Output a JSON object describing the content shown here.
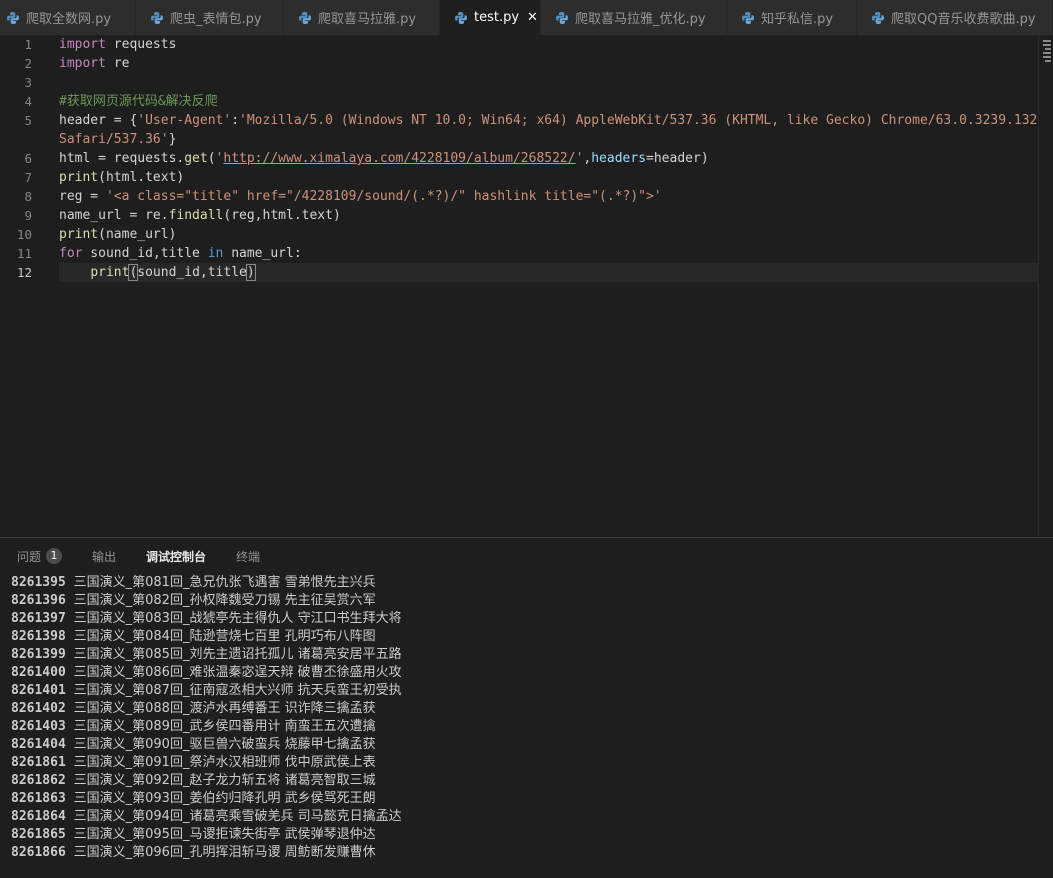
{
  "tabs": [
    {
      "label": "爬取全数网.py",
      "active": false
    },
    {
      "label": "爬虫_表情包.py",
      "active": false
    },
    {
      "label": "爬取喜马拉雅.py",
      "active": false
    },
    {
      "label": "test.py",
      "active": true
    },
    {
      "label": "爬取喜马拉雅_优化.py",
      "active": false
    },
    {
      "label": "知乎私信.py",
      "active": false
    },
    {
      "label": "爬取QQ音乐收费歌曲.py",
      "active": false
    }
  ],
  "editor": {
    "line_numbers": [
      "1",
      "2",
      "3",
      "4",
      "5",
      "",
      "6",
      "7",
      "8",
      "9",
      "10",
      "11",
      "12"
    ],
    "code": {
      "l1_kw": "import",
      "l1_rest": " requests",
      "l2_kw": "import",
      "l2_rest": " re",
      "l4_comment": "#获取网页源代码&解决反爬",
      "l5_a": "header = {",
      "l5_s1": "'User-Agent'",
      "l5_b": ":",
      "l5_s2": "'Mozilla/5.0 (Windows NT 10.0; Win64; x64) AppleWebKit/537.36 (KHTML, like Gecko) Chrome/63.0.3239.132",
      "l5w_s": "Safari/537.36'",
      "l5w_b": "}",
      "l6_a": "html = requests.",
      "l6_fn": "get",
      "l6_b": "(",
      "l6_q1": "'",
      "l6_url": "http://www.ximalaya.com/4228109/album/268522/",
      "l6_q2": "'",
      "l6_c": ",",
      "l6_param": "headers",
      "l6_d": "=header)",
      "l7_fn": "print",
      "l7_rest": "(html.text)",
      "l8_a": "reg = ",
      "l8_s": "'<a class=\"title\" href=\"/4228109/sound/(.*?)/\" hashlink title=\"(.*?)\">'",
      "l9_a": "name_url = re.",
      "l9_fn": "findall",
      "l9_rest": "(reg,html.text)",
      "l10_fn": "print",
      "l10_rest": "(name_url)",
      "l11_kw": "for",
      "l11_a": " sound_id,title ",
      "l11_in": "in",
      "l11_b": " name_url:",
      "l12_indent": "    ",
      "l12_fn": "print",
      "l12_open": "(",
      "l12_mid": "sound_id,title",
      "l12_close": ")"
    }
  },
  "panel": {
    "tabs": [
      {
        "label": "问题",
        "badge": "1"
      },
      {
        "label": "输出"
      },
      {
        "label": "调试控制台",
        "active": true
      },
      {
        "label": "终端"
      }
    ],
    "output": [
      {
        "id": "8261395",
        "text": "三国演义_第081回_急兄仇张飞遇害 雪弟恨先主兴兵"
      },
      {
        "id": "8261396",
        "text": "三国演义_第082回_孙权降魏受刀锡 先主征吴赏六军"
      },
      {
        "id": "8261397",
        "text": "三国演义_第083回_战猇亭先主得仇人 守江口书生拜大将"
      },
      {
        "id": "8261398",
        "text": "三国演义_第084回_陆逊营烧七百里 孔明巧布八阵图"
      },
      {
        "id": "8261399",
        "text": "三国演义_第085回_刘先主遗诏托孤儿 诸葛亮安居平五路"
      },
      {
        "id": "8261400",
        "text": "三国演义_第086回_难张温秦宓逞天辩 破曹丕徐盛用火攻"
      },
      {
        "id": "8261401",
        "text": "三国演义_第087回_征南寇丞相大兴师 抗天兵蛮王初受执"
      },
      {
        "id": "8261402",
        "text": "三国演义_第088回_渡泸水再缚番王 识诈降三擒孟获"
      },
      {
        "id": "8261403",
        "text": "三国演义_第089回_武乡侯四番用计 南蛮王五次遭擒"
      },
      {
        "id": "8261404",
        "text": "三国演义_第090回_驱巨兽六破蛮兵 烧藤甲七擒孟获"
      },
      {
        "id": "8261861",
        "text": "三国演义_第091回_祭泸水汉相班师 伐中原武侯上表"
      },
      {
        "id": "8261862",
        "text": "三国演义_第092回_赵子龙力斩五将 诸葛亮智取三城"
      },
      {
        "id": "8261863",
        "text": "三国演义_第093回_姜伯约归降孔明 武乡侯骂死王朗"
      },
      {
        "id": "8261864",
        "text": "三国演义_第094回_诸葛亮乘雪破羌兵 司马懿克日擒孟达"
      },
      {
        "id": "8261865",
        "text": "三国演义_第095回_马谡拒谏失街亭 武侯弹琴退仲达"
      },
      {
        "id": "8261866",
        "text": "三国演义_第096回_孔明挥泪斩马谡 周鲂断发赚曹休"
      }
    ]
  },
  "colors": {
    "python_icon": "#4f8fc3",
    "background": "#1e1e1e"
  }
}
